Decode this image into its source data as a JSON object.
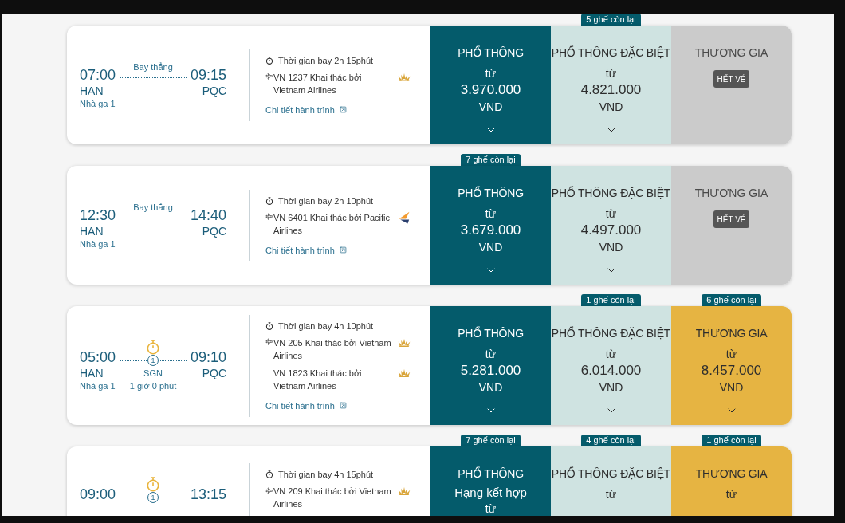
{
  "flights": [
    {
      "depart_time": "07:00",
      "depart_airport": "HAN",
      "depart_terminal": "Nhà ga 1",
      "route_label": "Bay thẳng",
      "arrive_time": "09:15",
      "arrive_airport": "PQC",
      "duration": "Thời gian bay 2h 15phút",
      "segments": [
        {
          "kind": "lotus",
          "text": "VN 1237 Khai thác bởi Vietnam Airlines",
          "show_plane": true
        }
      ],
      "details_link": "Chi tiết hành trình",
      "fares": [
        {
          "kind": "economy",
          "cabin": "PHỔ THÔNG",
          "from": "từ",
          "price": "3.970.000",
          "currency": "VND",
          "expanded": false
        },
        {
          "kind": "premium",
          "cabin": "PHỔ THÔNG ĐẶC BIỆT",
          "seats_left": "5 ghế còn lại",
          "from": "từ",
          "price": "4.821.000",
          "currency": "VND",
          "expanded": false
        },
        {
          "kind": "soldout",
          "cabin": "THƯƠNG GIA",
          "sold_out_label": "HẾT VÉ"
        }
      ]
    },
    {
      "depart_time": "12:30",
      "depart_airport": "HAN",
      "depart_terminal": "Nhà ga 1",
      "route_label": "Bay thẳng",
      "arrive_time": "14:40",
      "arrive_airport": "PQC",
      "duration": "Thời gian bay 2h 10phút",
      "segments": [
        {
          "kind": "wing",
          "text": "VN 6401 Khai thác bởi Pacific Airlines",
          "show_plane": true
        }
      ],
      "details_link": "Chi tiết hành trình",
      "fares": [
        {
          "kind": "economy",
          "cabin": "PHỔ THÔNG",
          "seats_left": "7 ghế còn lại",
          "from": "từ",
          "price": "3.679.000",
          "currency": "VND",
          "expanded": false
        },
        {
          "kind": "premium",
          "cabin": "PHỔ THÔNG ĐẶC BIỆT",
          "from": "từ",
          "price": "4.497.000",
          "currency": "VND",
          "expanded": false
        },
        {
          "kind": "soldout",
          "cabin": "THƯƠNG GIA",
          "sold_out_label": "HẾT VÉ"
        }
      ]
    },
    {
      "depart_time": "05:00",
      "depart_airport": "HAN",
      "depart_terminal": "Nhà ga 1",
      "stop": {
        "count": "1",
        "airport": "SGN",
        "layover": "1 giờ 0 phút"
      },
      "arrive_time": "09:10",
      "arrive_airport": "PQC",
      "duration": "Thời gian bay 4h 10phút",
      "segments": [
        {
          "kind": "lotus",
          "text": "VN 205 Khai thác bởi Vietnam Airlines",
          "show_plane": true
        },
        {
          "kind": "lotus",
          "text": "VN 1823 Khai thác bởi Vietnam Airlines",
          "show_plane": false
        }
      ],
      "details_link": "Chi tiết hành trình",
      "fares": [
        {
          "kind": "economy",
          "cabin": "PHỔ THÔNG",
          "from": "từ",
          "price": "5.281.000",
          "currency": "VND",
          "expanded": false
        },
        {
          "kind": "premium",
          "cabin": "PHỔ THÔNG ĐẶC BIỆT",
          "seats_left": "1 ghế còn lại",
          "from": "từ",
          "price": "6.014.000",
          "currency": "VND",
          "expanded": false
        },
        {
          "kind": "business",
          "cabin": "THƯƠNG GIA",
          "seats_left": "6 ghế còn lại",
          "from": "từ",
          "price": "8.457.000",
          "currency": "VND",
          "expanded": false
        }
      ]
    },
    {
      "depart_time": "09:00",
      "stop": {
        "count": "1"
      },
      "arrive_time": "13:15",
      "duration": "Thời gian bay 4h 15phút",
      "segments": [
        {
          "kind": "lotus",
          "text": "VN 209 Khai thác bởi Vietnam Airlines",
          "show_plane": true
        }
      ],
      "fares": [
        {
          "kind": "economy",
          "cabin": "PHỔ THÔNG",
          "subtitle": "Hạng kết hợp",
          "seats_left": "7 ghế còn lại",
          "from": "từ"
        },
        {
          "kind": "premium",
          "cabin": "PHỔ THÔNG ĐẶC BIỆT",
          "seats_left": "4 ghế còn lại",
          "from": "từ"
        },
        {
          "kind": "business",
          "cabin": "THƯƠNG GIA",
          "seats_left": "1 ghế còn lại",
          "from": "từ"
        }
      ]
    }
  ]
}
